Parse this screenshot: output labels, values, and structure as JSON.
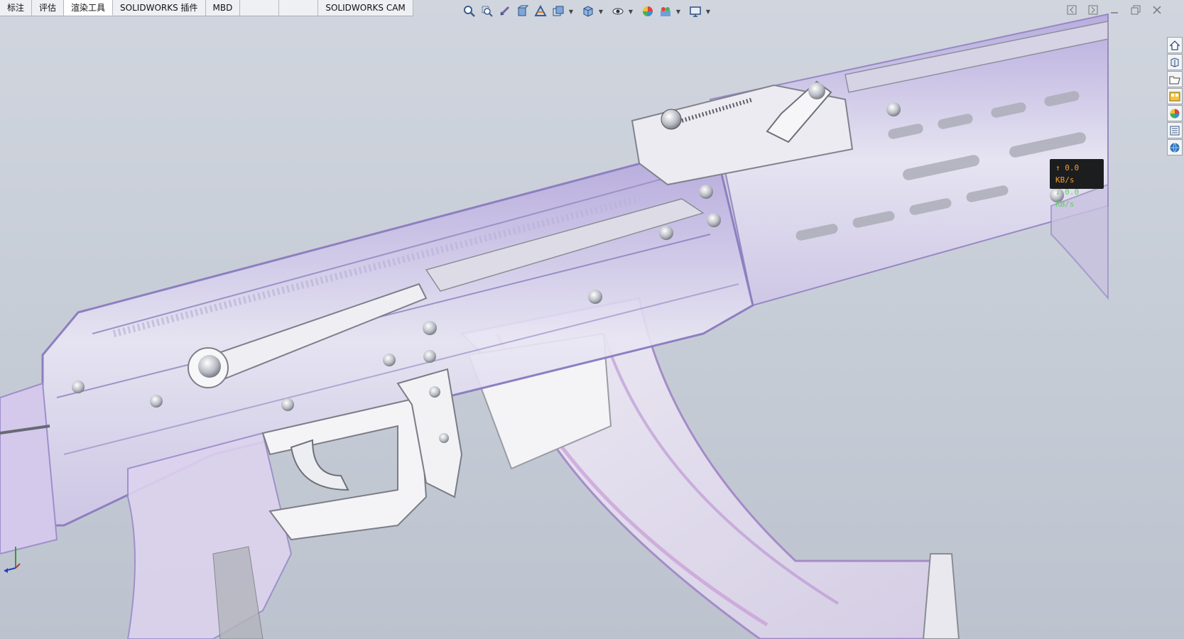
{
  "ribbon": {
    "tabs": [
      {
        "label": "标注",
        "active": false
      },
      {
        "label": "评估",
        "active": false
      },
      {
        "label": "渲染工具",
        "active": true
      },
      {
        "label": "SOLIDWORKS 插件",
        "active": false
      },
      {
        "label": "MBD",
        "active": false
      },
      {
        "label": "",
        "active": false
      },
      {
        "label": "SOLIDWORKS CAM",
        "active": false
      }
    ]
  },
  "heads_up_toolbar": {
    "icons": [
      "zoom-to-fit-icon",
      "zoom-to-area-icon",
      "previous-view-icon",
      "section-view-icon",
      "dynamic-annotation-icon",
      "view-orientation-icon",
      "display-style-icon",
      "hide-show-items-icon",
      "edit-appearance-icon",
      "apply-scene-icon",
      "view-settings-icon"
    ]
  },
  "task_pane": {
    "icons": [
      "home-icon",
      "resources-icon",
      "file-explorer-icon",
      "view-palette-icon",
      "appearances-icon",
      "custom-properties-icon",
      "community-icon"
    ]
  },
  "net_monitor": {
    "upload": "↑ 0.0 KB/s",
    "download": "↓ 0.0 KB/s"
  },
  "colors": {
    "accent_upload": "#f0a033",
    "accent_download": "#5fcf5f",
    "model_tint": "#b8a8dc",
    "background": "#c6ccd6"
  }
}
